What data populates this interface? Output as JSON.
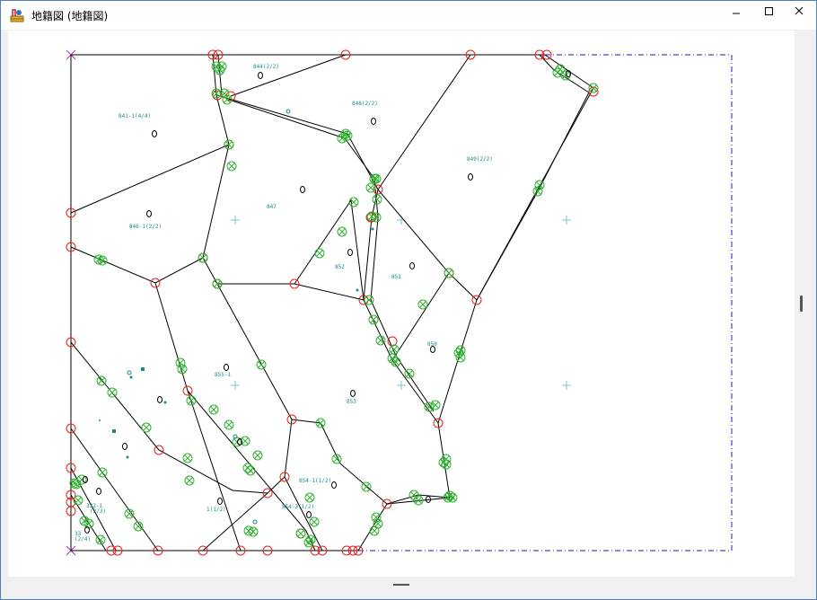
{
  "window": {
    "title": "地籍図 (地籍図)",
    "controls": [
      "minimize-icon",
      "maximize-icon",
      "close-icon"
    ]
  },
  "map": {
    "parcel_labels": [
      {
        "id": "p844",
        "text": "844(2/2)"
      },
      {
        "id": "p848",
        "text": "848(2/2)"
      },
      {
        "id": "p841",
        "text": "841-1(4/4)"
      },
      {
        "id": "p849",
        "text": "849(2/2)"
      },
      {
        "id": "p847",
        "text": "847"
      },
      {
        "id": "p846",
        "text": "846-1(2/2)"
      },
      {
        "id": "p852",
        "text": "852"
      },
      {
        "id": "p851",
        "text": "851"
      },
      {
        "id": "p850",
        "text": "850"
      },
      {
        "id": "p855",
        "text": "855-1"
      },
      {
        "id": "p853",
        "text": "853"
      },
      {
        "id": "p854a",
        "text": "854-1(1/2)"
      },
      {
        "id": "p854b",
        "text": "854-3(1/2)"
      },
      {
        "id": "p1_2",
        "text": "1(1/2)"
      },
      {
        "id": "p332",
        "text": "332-1"
      },
      {
        "id": "p2_3",
        "text": "(2/3)"
      },
      {
        "id": "p2_4",
        "text": "(2/4)"
      },
      {
        "id": "p33",
        "text": "33"
      }
    ],
    "colors": {
      "boundary": "#000000",
      "vertex": "#e8201c",
      "point": "#2fb12f",
      "label": "#1a8a8a",
      "frame": "#1f1fb0",
      "cross": "#7fc7c7",
      "corner": "#b030b0"
    }
  }
}
